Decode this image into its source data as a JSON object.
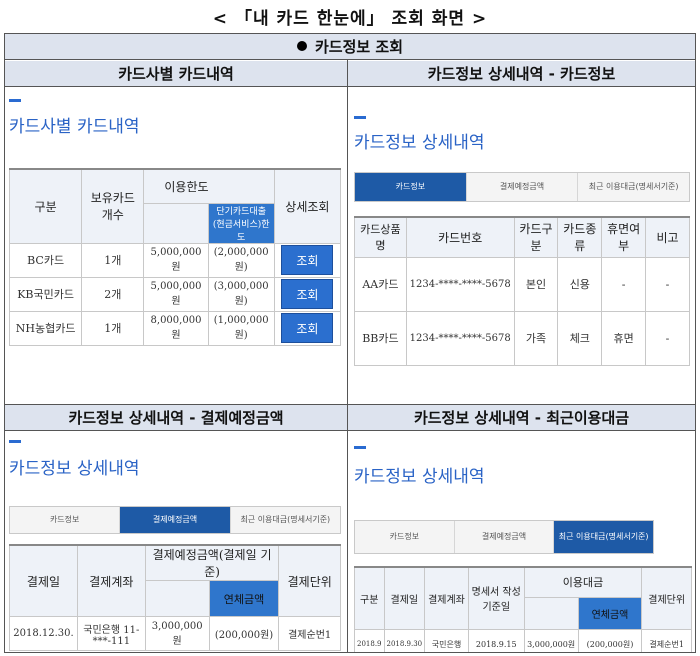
{
  "page_title": "< 「내 카드 한눈에」 조회 화면 >",
  "banner": "카드정보 조회",
  "q1": {
    "header": "카드사별 카드내역",
    "title": "카드사별 카드내역",
    "cols": {
      "gubun": "구분",
      "count": "보유카드 개수",
      "limit": "이용한도",
      "short": "단기카드대출 (현금서비스)한도",
      "detail": "상세조회"
    },
    "rows": [
      {
        "company": "BC카드",
        "count": "1개",
        "limit": "5,000,000원",
        "short": "(2,000,000원)",
        "button": "조회"
      },
      {
        "company": "KB국민카드",
        "count": "2개",
        "limit": "5,000,000원",
        "short": "(3,000,000원)",
        "button": "조회"
      },
      {
        "company": "NH농협카드",
        "count": "1개",
        "limit": "8,000,000원",
        "short": "(1,000,000원)",
        "button": "조회"
      }
    ]
  },
  "q2": {
    "header": "카드정보 상세내역 - 카드정보",
    "title": "카드정보 상세내역",
    "tabs": [
      "카드정보",
      "결제예정금액",
      "최근 이용대금(명세서기준)"
    ],
    "cols": [
      "카드상품명",
      "카드번호",
      "카드구분",
      "카드종류",
      "휴면여부",
      "비고"
    ],
    "rows": [
      [
        "AA카드",
        "1234-****-****-5678",
        "본인",
        "신용",
        "-",
        "-"
      ],
      [
        "BB카드",
        "1234-****-****-5678",
        "가족",
        "체크",
        "휴면",
        "-"
      ]
    ]
  },
  "q3": {
    "header": "카드정보 상세내역 - 결제예정금액",
    "title": "카드정보 상세내역",
    "tabs": [
      "카드정보",
      "결제예정금액",
      "최근 이용대금(명세서기준)"
    ],
    "cols": {
      "date": "결제일",
      "account": "결제계좌",
      "amount": "결제예정금액(결제일 기준)",
      "overdue": "연체금액",
      "unit": "결제단위"
    },
    "row": {
      "date": "2018.12.30.",
      "account": "국민은행 11-***-111",
      "amount": "3,000,000원",
      "overdue": "(200,000원)",
      "unit": "결제순번1"
    }
  },
  "q4": {
    "header": "카드정보 상세내역 - 최근이용대금",
    "title": "카드정보 상세내역",
    "tabs": [
      "카드정보",
      "결제예정금액",
      "최근 이용대금(명세서기준)"
    ],
    "cols": {
      "gubun": "구분",
      "date": "결제일",
      "account": "결제계좌",
      "stmt": "명세서 작성기준일",
      "usage": "이용대금",
      "overdue": "연체금액",
      "unit": "결제단위"
    },
    "row": {
      "gubun": "2018.9",
      "date": "2018.9.30",
      "account": "국민은행",
      "stmt": "2018.9.15",
      "usage": "3,000,000원",
      "overdue": "(200,000원)",
      "unit": "결제순번1"
    }
  }
}
